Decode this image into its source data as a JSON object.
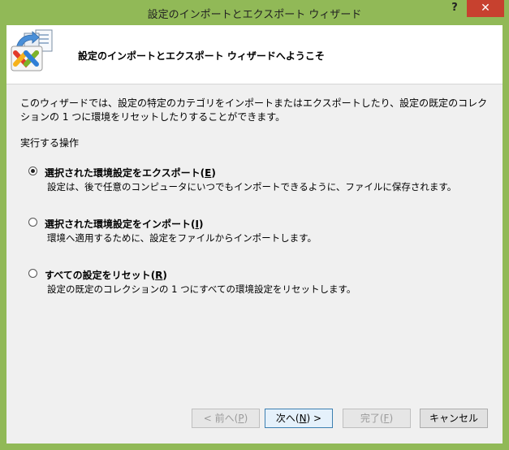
{
  "window": {
    "title": "設定のインポートとエクスポート ウィザード",
    "help_glyph": "?",
    "close_glyph": "✕"
  },
  "header": {
    "title": "設定のインポートとエクスポート ウィザードへようこそ",
    "logo_icon": "visual-studio-settings-wizard-icon"
  },
  "intro": {
    "text": "このウィザードでは、設定の特定のカテゴリをインポートまたはエクスポートしたり、設定の既定のコレクションの 1 つに環境をリセットしたりすることができます。"
  },
  "actions": {
    "label": "実行する操作",
    "options": [
      {
        "label": "選択された環境設定をエクスポート",
        "accel": "E",
        "description": "設定は、後で任意のコンピュータにいつでもインポートできるように、ファイルに保存されます。",
        "selected": true
      },
      {
        "label": "選択された環境設定をインポート",
        "accel": "I",
        "description": "環境へ適用するために、設定をファイルからインポートします。",
        "selected": false
      },
      {
        "label": "すべての設定をリセット",
        "accel": "R",
        "description": "設定の既定のコレクションの 1 つにすべての環境設定をリセットします。",
        "selected": false
      }
    ]
  },
  "buttons": {
    "back": {
      "prefix": "< 前へ(",
      "accel": "P",
      "suffix": ")",
      "enabled": false
    },
    "next": {
      "prefix": "次へ(",
      "accel": "N",
      "suffix": ") >",
      "enabled": true
    },
    "finish": {
      "prefix": "完了(",
      "accel": "F",
      "suffix": ")",
      "enabled": false
    },
    "cancel": {
      "label": "キャンセル",
      "enabled": true
    }
  }
}
